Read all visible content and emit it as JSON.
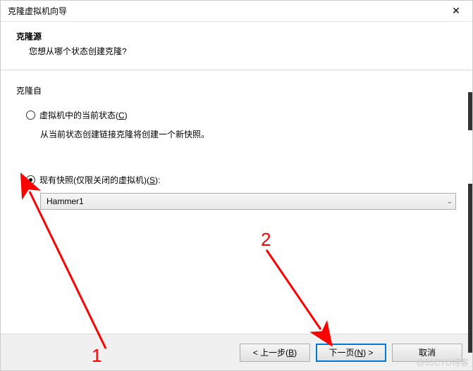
{
  "window": {
    "title": "克隆虚拟机向导"
  },
  "header": {
    "title": "克隆源",
    "subtitle": "您想从哪个状态创建克隆?"
  },
  "group": {
    "label": "克隆自"
  },
  "option_current": {
    "label_pre": "虚拟机中的当前状态(",
    "mnemonic": "C",
    "label_post": ")",
    "description": "从当前状态创建链接克隆将创建一个新快照。"
  },
  "option_snapshot": {
    "label_pre": "现有快照(仅限关闭的虚拟机)(",
    "mnemonic": "S",
    "label_post": "):",
    "selected_value": "Hammer1"
  },
  "buttons": {
    "back_pre": "< 上一步(",
    "back_m": "B",
    "back_post": ")",
    "next_pre": "下一页(",
    "next_m": "N",
    "next_post": ") >",
    "cancel": "取消"
  },
  "annotations": {
    "num1": "1",
    "num2": "2"
  },
  "watermark": "@51CTO博客"
}
